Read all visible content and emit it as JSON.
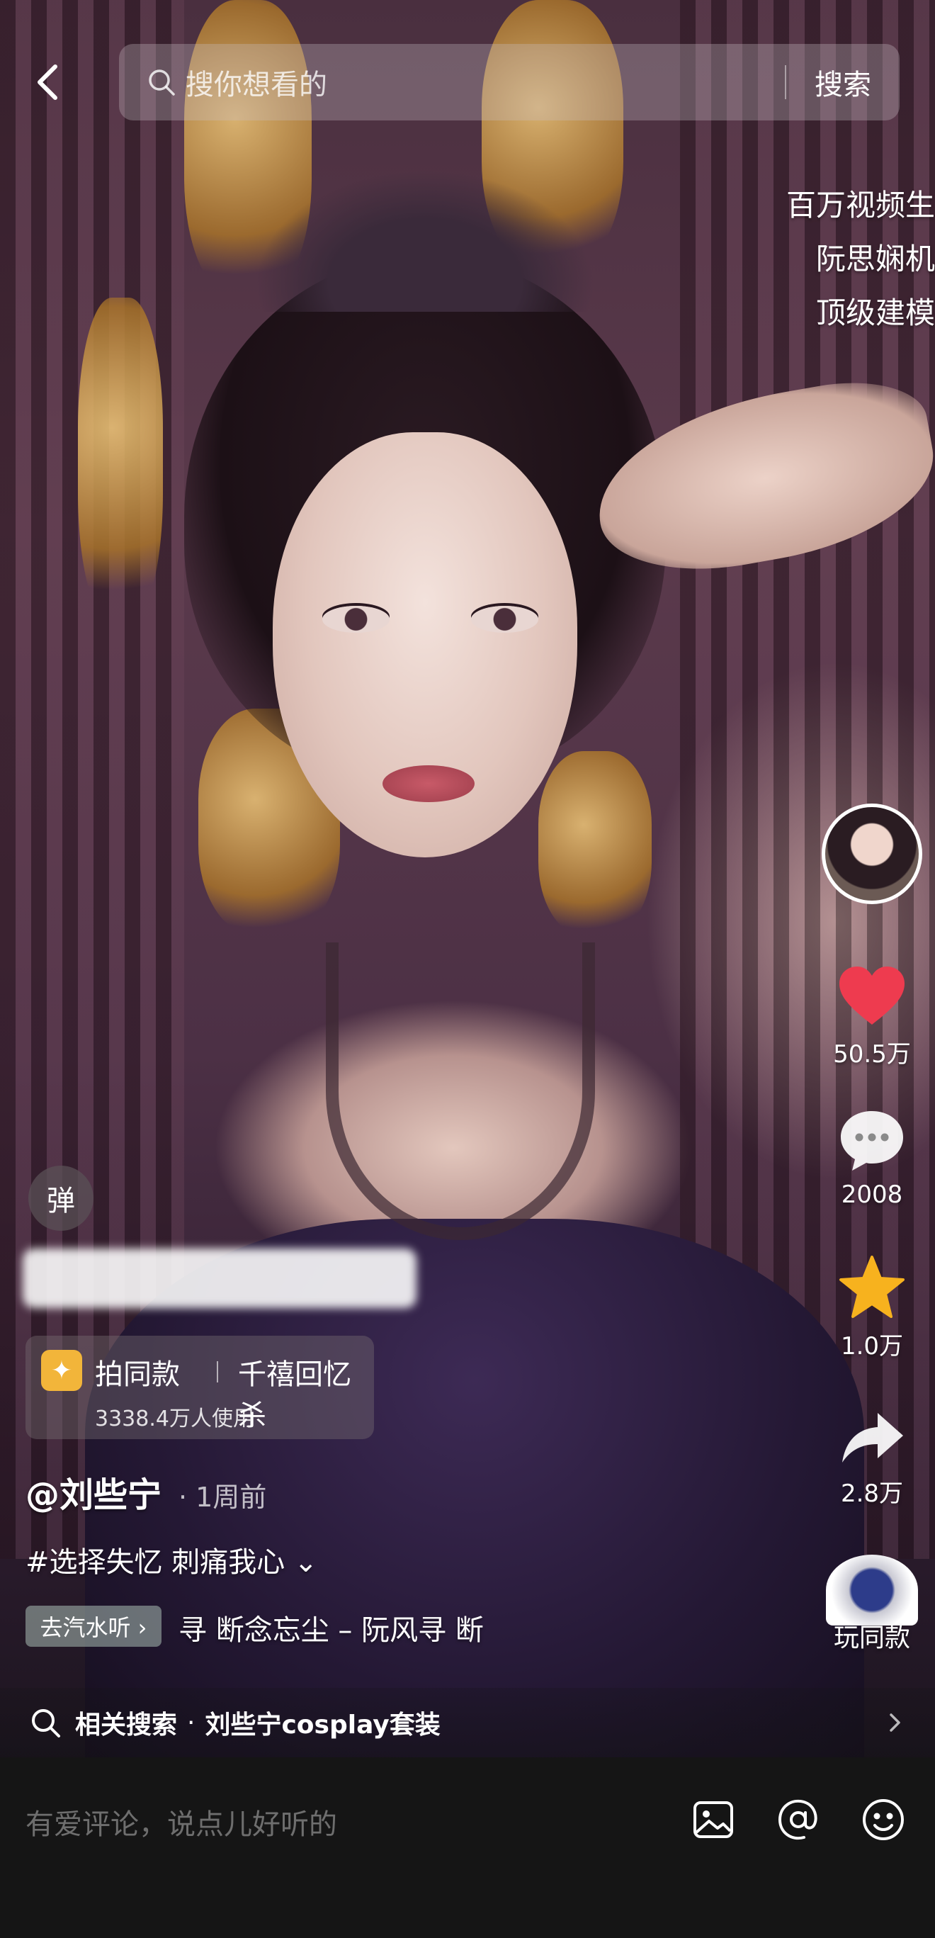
{
  "search": {
    "placeholder": "搜你想看的",
    "button_label": "搜索"
  },
  "overlay_text": [
    "百万视频生",
    "阮思娴机",
    "顶级建模"
  ],
  "rail": {
    "likes": "50.5万",
    "comments": "2008",
    "favorites": "1.0万",
    "shares": "2.8万",
    "same_style": "玩同款"
  },
  "danmaku_label": "弹",
  "effect": {
    "name": "拍同款",
    "title": "千禧回忆杀",
    "users": "3338.4万人使用"
  },
  "post": {
    "author": "@刘些宁",
    "time": "· 1周前",
    "description": "#选择失忆  刺痛我心 ⌄",
    "music_chip": "去汽水听 ›",
    "music_text": "寻  断念忘尘 – 阮风寻  断"
  },
  "related_search": {
    "label": "相关搜索",
    "dot": "·",
    "term": "刘些宁cosplay套装"
  },
  "comment": {
    "placeholder": "有爱评论，说点儿好听的"
  },
  "colors": {
    "like": "#ee3b4f",
    "favorite": "#f7b21e",
    "effect_icon": "#f2b53a"
  }
}
